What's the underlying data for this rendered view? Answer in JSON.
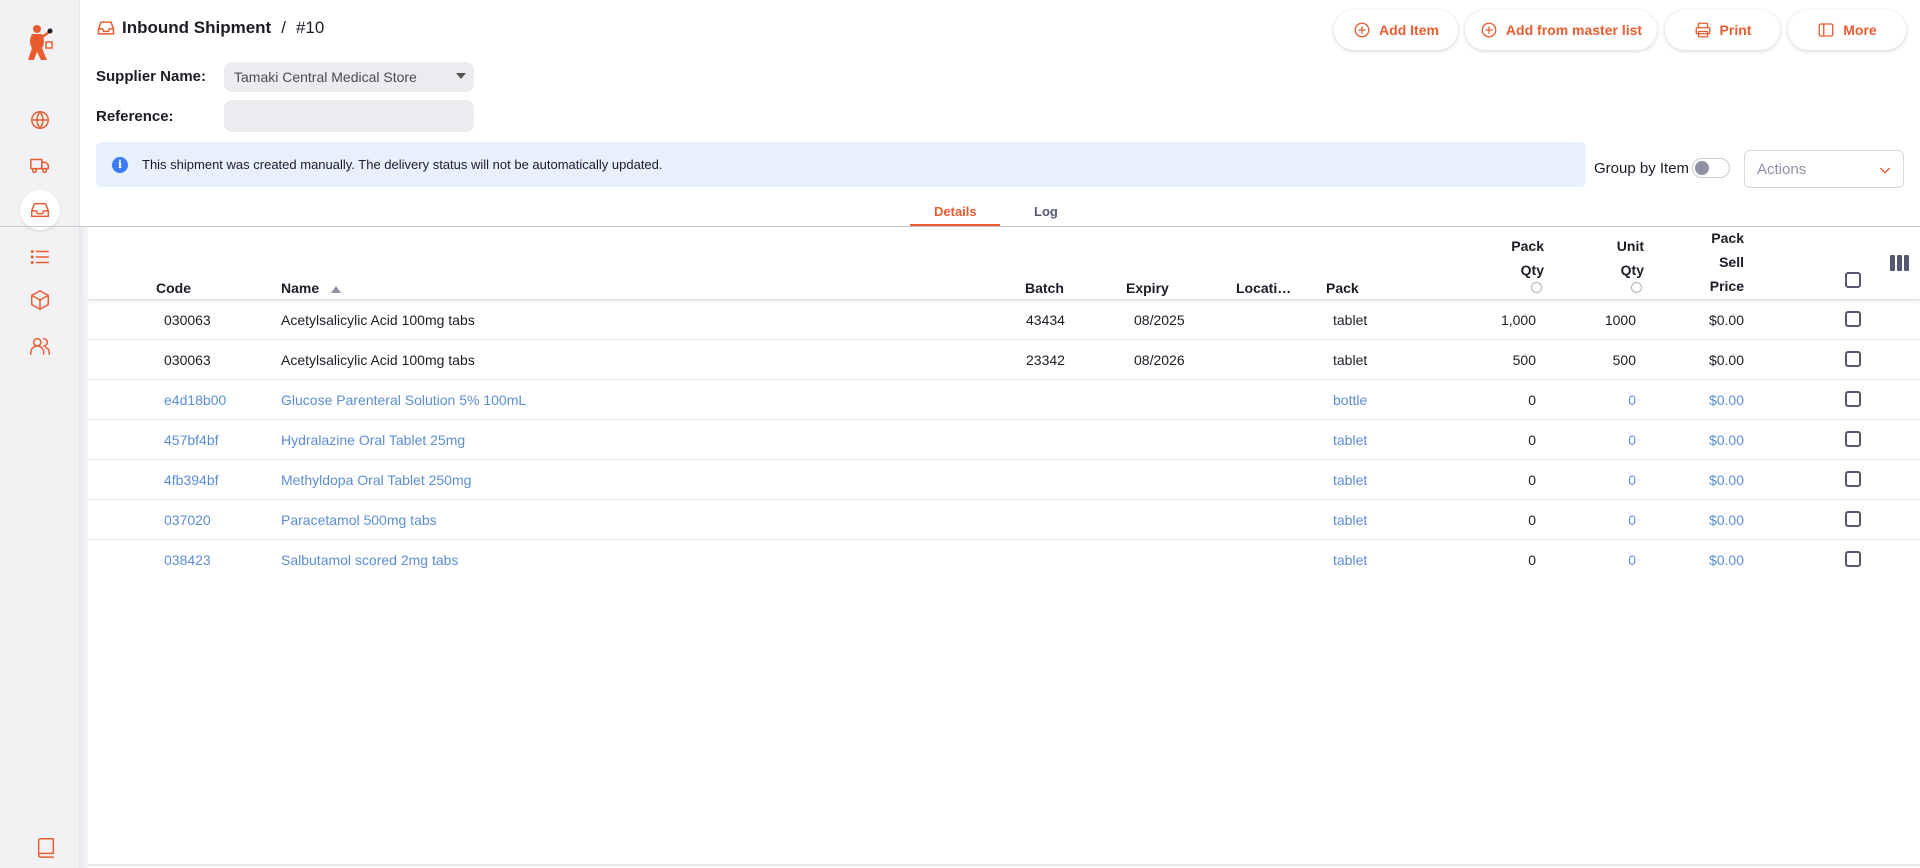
{
  "header": {
    "title": "Inbound Shipment",
    "separator": "/",
    "number": "#10"
  },
  "toolbar": {
    "add_item": "Add Item",
    "add_from_master": "Add from master list",
    "print": "Print",
    "more": "More"
  },
  "form": {
    "supplier_label": "Supplier Name:",
    "supplier_value": "Tamaki Central Medical Store",
    "reference_label": "Reference:",
    "reference_value": ""
  },
  "banner": {
    "message": "This shipment was created manually. The delivery status will not be automatically updated."
  },
  "controls": {
    "group_by_label": "Group by Item",
    "actions_placeholder": "Actions"
  },
  "tabs": [
    "Details",
    "Log"
  ],
  "table": {
    "headers": {
      "code": "Code",
      "name": "Name",
      "batch": "Batch",
      "expiry": "Expiry",
      "location": "Locati…",
      "pack": "Pack",
      "pack_qty_1": "Pack",
      "pack_qty_2": "Qty",
      "unit_qty_1": "Unit",
      "unit_qty_2": "Qty",
      "sell_1": "Pack",
      "sell_2": "Sell",
      "sell_3": "Price"
    },
    "rows": [
      {
        "code": "030063",
        "name": "Acetylsalicylic Acid 100mg tabs",
        "batch": "43434",
        "expiry": "08/2025",
        "pack": "tablet",
        "pack_qty": "1,000",
        "unit_qty": "1000",
        "price": "$0.00"
      },
      {
        "code": "030063",
        "name": "Acetylsalicylic Acid 100mg tabs",
        "batch": "23342",
        "expiry": "08/2026",
        "pack": "tablet",
        "pack_qty": "500",
        "unit_qty": "500",
        "price": "$0.00"
      },
      {
        "code": "e4d18b00",
        "name": "Glucose Parenteral Solution 5% 100mL",
        "batch": "",
        "expiry": "",
        "pack": "bottle",
        "pack_qty": "0",
        "unit_qty": "0",
        "price": "$0.00"
      },
      {
        "code": "457bf4bf",
        "name": "Hydralazine Oral Tablet 25mg",
        "batch": "",
        "expiry": "",
        "pack": "tablet",
        "pack_qty": "0",
        "unit_qty": "0",
        "price": "$0.00"
      },
      {
        "code": "4fb394bf",
        "name": "Methyldopa Oral Tablet 250mg",
        "batch": "",
        "expiry": "",
        "pack": "tablet",
        "pack_qty": "0",
        "unit_qty": "0",
        "price": "$0.00"
      },
      {
        "code": "037020",
        "name": "Paracetamol 500mg tabs",
        "batch": "",
        "expiry": "",
        "pack": "tablet",
        "pack_qty": "0",
        "unit_qty": "0",
        "price": "$0.00"
      },
      {
        "code": "038423",
        "name": "Salbutamol scored 2mg tabs",
        "batch": "",
        "expiry": "",
        "pack": "tablet",
        "pack_qty": "0",
        "unit_qty": "0",
        "price": "$0.00"
      }
    ]
  },
  "colors": {
    "accent": "#e95c30",
    "placeholder_row_text": "#5b8dd6",
    "banner_bg": "#e8f0fc",
    "sidebar_bg": "#f2f2f5"
  },
  "icons": {
    "sidebar": [
      "globe-icon",
      "truck-icon",
      "inbox-icon",
      "list-icon",
      "box-icon",
      "users-icon",
      "book-icon"
    ]
  }
}
